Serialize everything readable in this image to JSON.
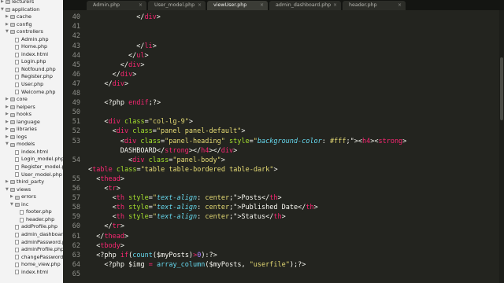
{
  "sidebar": {
    "items": [
      {
        "label": "lecturers",
        "depth": 0,
        "type": "folder",
        "open": false
      },
      {
        "label": "application",
        "depth": 0,
        "type": "folder",
        "open": true
      },
      {
        "label": "cache",
        "depth": 1,
        "type": "folder",
        "open": false
      },
      {
        "label": "config",
        "depth": 1,
        "type": "folder",
        "open": false
      },
      {
        "label": "controllers",
        "depth": 1,
        "type": "folder",
        "open": true
      },
      {
        "label": "Admin.php",
        "depth": 2,
        "type": "file"
      },
      {
        "label": "Home.php",
        "depth": 2,
        "type": "file"
      },
      {
        "label": "index.html",
        "depth": 2,
        "type": "file"
      },
      {
        "label": "Login.php",
        "depth": 2,
        "type": "file"
      },
      {
        "label": "Notfound.php",
        "depth": 2,
        "type": "file"
      },
      {
        "label": "Register.php",
        "depth": 2,
        "type": "file"
      },
      {
        "label": "User.php",
        "depth": 2,
        "type": "file"
      },
      {
        "label": "Welcome.php",
        "depth": 2,
        "type": "file"
      },
      {
        "label": "core",
        "depth": 1,
        "type": "folder",
        "open": false
      },
      {
        "label": "helpers",
        "depth": 1,
        "type": "folder",
        "open": false
      },
      {
        "label": "hooks",
        "depth": 1,
        "type": "folder",
        "open": false
      },
      {
        "label": "language",
        "depth": 1,
        "type": "folder",
        "open": false
      },
      {
        "label": "libraries",
        "depth": 1,
        "type": "folder",
        "open": false
      },
      {
        "label": "logs",
        "depth": 1,
        "type": "folder",
        "open": false
      },
      {
        "label": "models",
        "depth": 1,
        "type": "folder",
        "open": true
      },
      {
        "label": "index.html",
        "depth": 2,
        "type": "file"
      },
      {
        "label": "Login_model.php",
        "depth": 2,
        "type": "file"
      },
      {
        "label": "Register_model.php",
        "depth": 2,
        "type": "file"
      },
      {
        "label": "User_model.php",
        "depth": 2,
        "type": "file"
      },
      {
        "label": "third_party",
        "depth": 1,
        "type": "folder",
        "open": false
      },
      {
        "label": "views",
        "depth": 1,
        "type": "folder",
        "open": true
      },
      {
        "label": "errors",
        "depth": 2,
        "type": "folder",
        "open": false
      },
      {
        "label": "inc",
        "depth": 2,
        "type": "folder",
        "open": true
      },
      {
        "label": "footer.php",
        "depth": 3,
        "type": "file"
      },
      {
        "label": "header.php",
        "depth": 3,
        "type": "file"
      },
      {
        "label": "addProfile.php",
        "depth": 2,
        "type": "file"
      },
      {
        "label": "admin_dashboard",
        "depth": 2,
        "type": "file"
      },
      {
        "label": "adminPassword.p",
        "depth": 2,
        "type": "file"
      },
      {
        "label": "adminProfile.php",
        "depth": 2,
        "type": "file"
      },
      {
        "label": "changePassword",
        "depth": 2,
        "type": "file"
      },
      {
        "label": "home_view.php",
        "depth": 2,
        "type": "file"
      },
      {
        "label": "index.html",
        "depth": 2,
        "type": "file"
      }
    ]
  },
  "tabs": [
    {
      "label": "Admin.php",
      "active": false
    },
    {
      "label": "User_model.php",
      "active": false
    },
    {
      "label": "viewUser.php",
      "active": true
    },
    {
      "label": "admin_dashboard.php",
      "active": false
    },
    {
      "label": "header.php",
      "active": false
    }
  ],
  "tab_close_glyph": "×",
  "editor": {
    "lines": [
      {
        "n": "40",
        "indent": 12,
        "tokens": [
          [
            "p",
            "</"
          ],
          [
            "tag",
            "div"
          ],
          [
            "p",
            ">"
          ]
        ]
      },
      {
        "n": "41",
        "indent": 0,
        "tokens": []
      },
      {
        "n": "42",
        "indent": 0,
        "tokens": []
      },
      {
        "n": "43",
        "indent": 12,
        "tokens": [
          [
            "p",
            "</"
          ],
          [
            "tag",
            "li"
          ],
          [
            "p",
            ">"
          ]
        ]
      },
      {
        "n": "44",
        "indent": 10,
        "tokens": [
          [
            "p",
            "</"
          ],
          [
            "tag",
            "ul"
          ],
          [
            "p",
            ">"
          ]
        ]
      },
      {
        "n": "45",
        "indent": 8,
        "tokens": [
          [
            "p",
            "</"
          ],
          [
            "tag",
            "div"
          ],
          [
            "p",
            ">"
          ]
        ]
      },
      {
        "n": "46",
        "indent": 6,
        "tokens": [
          [
            "p",
            "</"
          ],
          [
            "tag",
            "div"
          ],
          [
            "p",
            ">"
          ]
        ]
      },
      {
        "n": "47",
        "indent": 4,
        "tokens": [
          [
            "p",
            "</"
          ],
          [
            "tag",
            "div"
          ],
          [
            "p",
            ">"
          ]
        ]
      },
      {
        "n": "48",
        "indent": 0,
        "tokens": []
      },
      {
        "n": "49",
        "indent": 4,
        "tokens": [
          [
            "p",
            "<?php "
          ],
          [
            "kw",
            "endif"
          ],
          [
            "p",
            ";?>"
          ]
        ]
      },
      {
        "n": "50",
        "indent": 0,
        "tokens": []
      },
      {
        "n": "51",
        "indent": 4,
        "tokens": [
          [
            "p",
            "<"
          ],
          [
            "tag",
            "div"
          ],
          [
            "p",
            " "
          ],
          [
            "attr",
            "class"
          ],
          [
            "p",
            "="
          ],
          [
            "str",
            "\"col-lg-9\""
          ],
          [
            "p",
            ">"
          ]
        ]
      },
      {
        "n": "52",
        "indent": 6,
        "tokens": [
          [
            "p",
            "<"
          ],
          [
            "tag",
            "div"
          ],
          [
            "p",
            " "
          ],
          [
            "attr",
            "class"
          ],
          [
            "p",
            "="
          ],
          [
            "str",
            "\"panel panel-default\""
          ],
          [
            "p",
            ">"
          ]
        ]
      },
      {
        "n": "53",
        "indent": 8,
        "tokens": [
          [
            "p",
            "<"
          ],
          [
            "tag",
            "div"
          ],
          [
            "p",
            " "
          ],
          [
            "attr",
            "class"
          ],
          [
            "p",
            "="
          ],
          [
            "str",
            "\"panel-heading\""
          ],
          [
            "p",
            " "
          ],
          [
            "attr",
            "style"
          ],
          [
            "p",
            "="
          ],
          [
            "str",
            "\""
          ],
          [
            "it",
            "background-color"
          ],
          [
            "p",
            ": "
          ],
          [
            "str",
            "#fff"
          ],
          [
            "p",
            ";\">"
          ],
          [
            "p",
            "<"
          ],
          [
            "tag",
            "h4"
          ],
          [
            "p",
            ">"
          ],
          [
            "p",
            "<"
          ],
          [
            "tag",
            "strong"
          ],
          [
            "p",
            ">"
          ]
        ]
      },
      {
        "n": "",
        "indent": 8,
        "tokens": [
          [
            "p",
            "DASHBOARD</"
          ],
          [
            "tag",
            "strong"
          ],
          [
            "p",
            "></"
          ],
          [
            "tag",
            "h4"
          ],
          [
            "p",
            "></"
          ],
          [
            "tag",
            "div"
          ],
          [
            "p",
            ">"
          ]
        ]
      },
      {
        "n": "54",
        "indent": 10,
        "tokens": [
          [
            "p",
            "<"
          ],
          [
            "tag",
            "div"
          ],
          [
            "p",
            " "
          ],
          [
            "attr",
            "class"
          ],
          [
            "p",
            "="
          ],
          [
            "str",
            "\"panel-body\""
          ],
          [
            "p",
            ">"
          ]
        ]
      },
      {
        "n": "",
        "indent": 0,
        "tokens": [
          [
            "p",
            "<"
          ],
          [
            "tag",
            "table"
          ],
          [
            "p",
            " "
          ],
          [
            "attr",
            "class"
          ],
          [
            "p",
            "="
          ],
          [
            "str",
            "\"table table-bordered table-dark\""
          ],
          [
            "p",
            ">"
          ]
        ]
      },
      {
        "n": "55",
        "indent": 2,
        "tokens": [
          [
            "p",
            "<"
          ],
          [
            "tag",
            "thead"
          ],
          [
            "p",
            ">"
          ]
        ]
      },
      {
        "n": "56",
        "indent": 4,
        "tokens": [
          [
            "p",
            "<"
          ],
          [
            "tag",
            "tr"
          ],
          [
            "p",
            ">"
          ]
        ]
      },
      {
        "n": "57",
        "indent": 6,
        "tokens": [
          [
            "p",
            "<"
          ],
          [
            "tag",
            "th"
          ],
          [
            "p",
            " "
          ],
          [
            "attr",
            "style"
          ],
          [
            "p",
            "="
          ],
          [
            "str",
            "\""
          ],
          [
            "it",
            "text-align"
          ],
          [
            "p",
            ": "
          ],
          [
            "str",
            "center"
          ],
          [
            "p",
            ";\">Posts</"
          ],
          [
            "tag",
            "th"
          ],
          [
            "p",
            ">"
          ]
        ]
      },
      {
        "n": "58",
        "indent": 6,
        "tokens": [
          [
            "p",
            "<"
          ],
          [
            "tag",
            "th"
          ],
          [
            "p",
            " "
          ],
          [
            "attr",
            "style"
          ],
          [
            "p",
            "="
          ],
          [
            "str",
            "\""
          ],
          [
            "it",
            "text-align"
          ],
          [
            "p",
            ": "
          ],
          [
            "str",
            "center"
          ],
          [
            "p",
            ";\">Published Date</"
          ],
          [
            "tag",
            "th"
          ],
          [
            "p",
            ">"
          ]
        ]
      },
      {
        "n": "59",
        "indent": 6,
        "tokens": [
          [
            "p",
            "<"
          ],
          [
            "tag",
            "th"
          ],
          [
            "p",
            " "
          ],
          [
            "attr",
            "style"
          ],
          [
            "p",
            "="
          ],
          [
            "str",
            "\""
          ],
          [
            "it",
            "text-align"
          ],
          [
            "p",
            ": "
          ],
          [
            "str",
            "center"
          ],
          [
            "p",
            ";\">Status</"
          ],
          [
            "tag",
            "th"
          ],
          [
            "p",
            ">"
          ]
        ]
      },
      {
        "n": "60",
        "indent": 4,
        "tokens": [
          [
            "p",
            "</"
          ],
          [
            "tag",
            "tr"
          ],
          [
            "p",
            ">"
          ]
        ]
      },
      {
        "n": "61",
        "indent": 2,
        "tokens": [
          [
            "p",
            "</"
          ],
          [
            "tag",
            "thead"
          ],
          [
            "p",
            ">"
          ]
        ]
      },
      {
        "n": "62",
        "indent": 2,
        "tokens": [
          [
            "p",
            "<"
          ],
          [
            "tag",
            "tbody"
          ],
          [
            "p",
            ">"
          ]
        ]
      },
      {
        "n": "63",
        "indent": 2,
        "tokens": [
          [
            "p",
            "<?php "
          ],
          [
            "kw",
            "if"
          ],
          [
            "p",
            "("
          ],
          [
            "fn",
            "count"
          ],
          [
            "p",
            "($myPosts)"
          ],
          [
            "kw",
            ">"
          ],
          [
            "num",
            "0"
          ],
          [
            "p",
            "):?>"
          ]
        ]
      },
      {
        "n": "64",
        "indent": 4,
        "tokens": [
          [
            "p",
            "<?php "
          ],
          [
            "var",
            "$img"
          ],
          [
            "p",
            " "
          ],
          [
            "kw",
            "="
          ],
          [
            "p",
            " "
          ],
          [
            "fn",
            "array_column"
          ],
          [
            "p",
            "($myPosts, "
          ],
          [
            "str",
            "\"userfile\""
          ],
          [
            "p",
            ");?>"
          ]
        ]
      },
      {
        "n": "65",
        "indent": 0,
        "tokens": []
      }
    ]
  },
  "colors": {
    "editor_bg": "#23241f",
    "tag": "#f92672",
    "attr": "#a6e22e",
    "string": "#e6db74",
    "function": "#66d9ef",
    "number": "#ae81ff",
    "line_number": "#8f908a"
  }
}
